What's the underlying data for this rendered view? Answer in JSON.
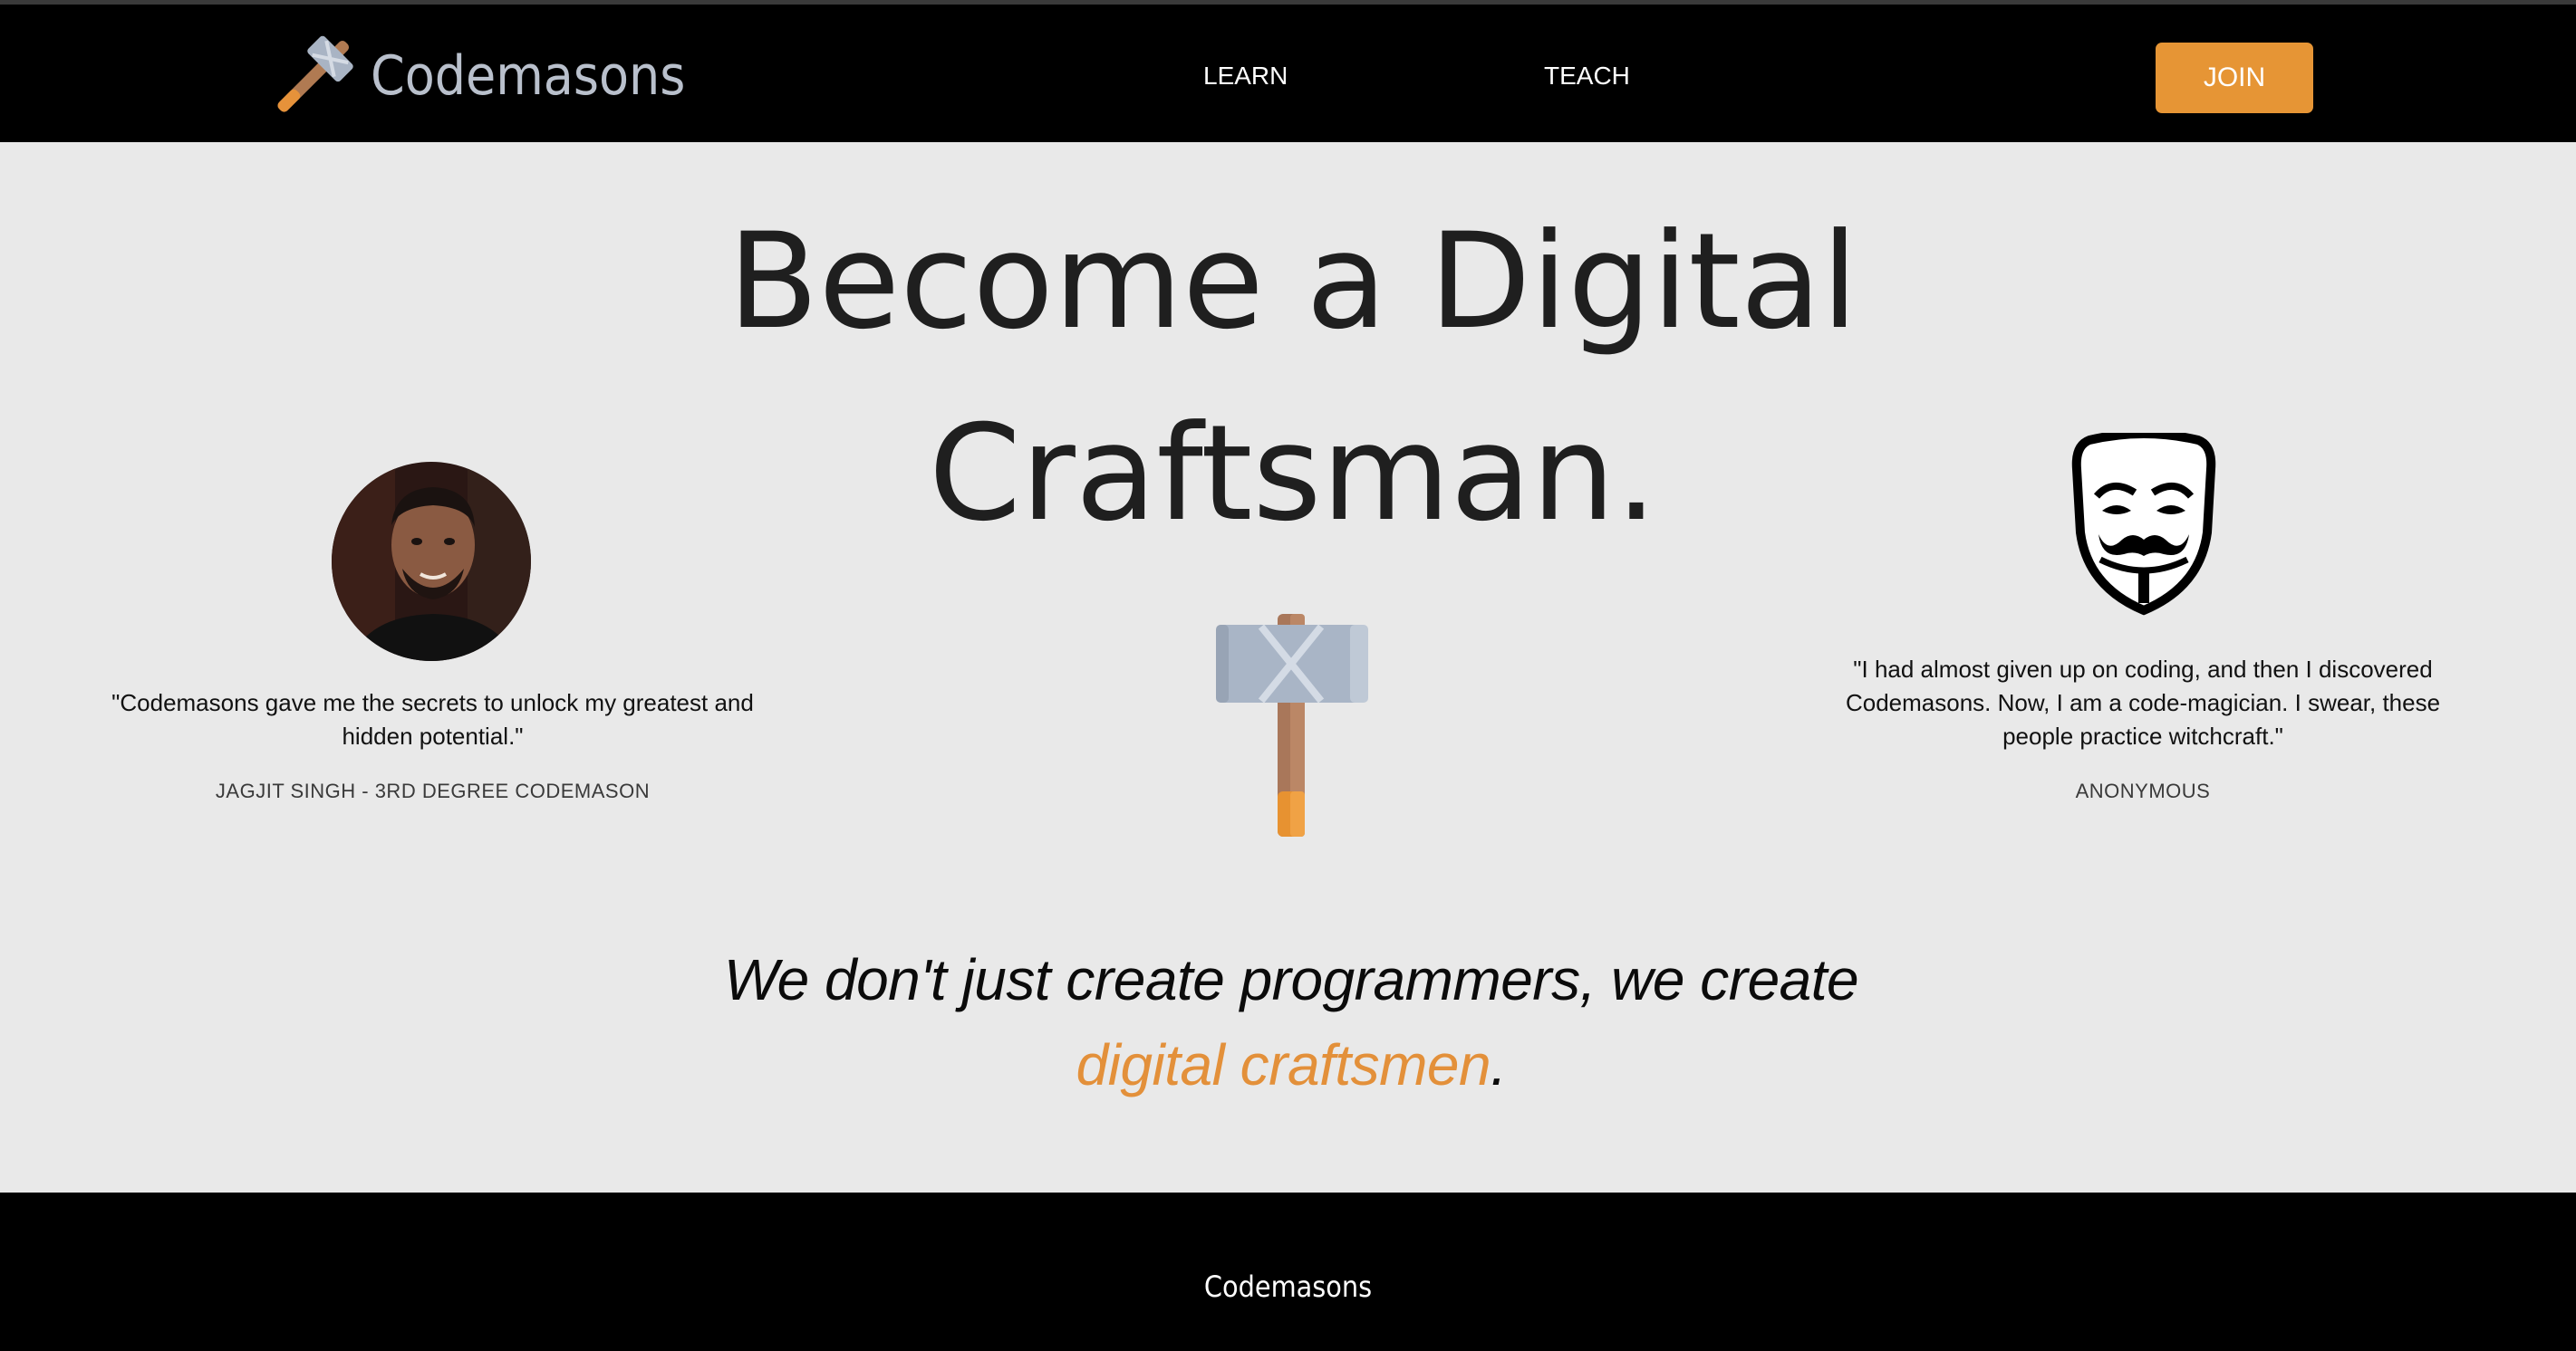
{
  "colors": {
    "accent": "#e69535",
    "nav_background": "#000000",
    "page_background": "#e9e9e9",
    "brand_text": "#b9c0cc"
  },
  "header": {
    "brand_name": "Codemasons",
    "brand_icon": "hammer-icon",
    "nav": {
      "learn": "LEARN",
      "teach": "TEACH"
    },
    "join_label": "JOIN"
  },
  "hero": {
    "title_line1": "Become a Digital",
    "title_line2": "Craftsman.",
    "center_icon": "hammer-icon"
  },
  "testimonials": [
    {
      "quote_line1": "\"Codemasons gave me the secrets to unlock my greatest and",
      "quote_line2": "hidden potential.\"",
      "author": "JAGJIT SINGH - 3RD DEGREE CODEMASON",
      "image": "avatar-photo"
    },
    {
      "quote_line1": "\"I had almost given up on coding, and then I discovered",
      "quote_line2": "Codemasons. Now, I am a code-magician. I swear, these",
      "quote_line3": "people practice witchcraft.\"",
      "author": "ANONYMOUS",
      "image": "anonymous-mask-icon"
    }
  ],
  "tagline": {
    "line1": "We don't just create programmers, we create",
    "highlight": "digital craftsmen",
    "end": "."
  },
  "footer": {
    "brand_name": "Codemasons"
  }
}
